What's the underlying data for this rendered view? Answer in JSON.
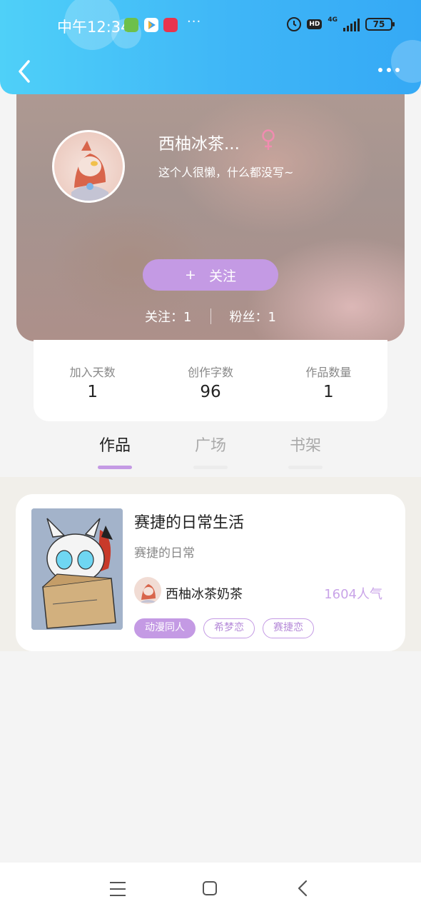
{
  "status_bar": {
    "time": "中午12:34",
    "more": "···",
    "network": "4G",
    "hd_badge": "HD",
    "battery": "75"
  },
  "header": {
    "back_icon": "chevron-left-icon",
    "more_icon": "more-dots-icon"
  },
  "profile": {
    "username": "西柚冰茶...",
    "gender_icon": "female-icon",
    "bio": "这个人很懒，什么都没写~",
    "follow_button": "关注",
    "follow_plus": "+",
    "following_label": "关注：1",
    "followers_label": "粉丝：1",
    "follow_button_color": "#c49ae4"
  },
  "stats": [
    {
      "label": "加入天数",
      "value": "1"
    },
    {
      "label": "创作字数",
      "value": "96"
    },
    {
      "label": "作品数量",
      "value": "1"
    }
  ],
  "tabs": [
    {
      "label": "作品",
      "active": true
    },
    {
      "label": "广场",
      "active": false
    },
    {
      "label": "书架",
      "active": false
    }
  ],
  "works": [
    {
      "title": "赛捷的日常生活",
      "description": "赛捷的日常",
      "author": "西柚冰茶奶茶",
      "popularity": "1604人气",
      "tags": [
        "动漫同人",
        "希梦恋",
        "赛捷恋"
      ]
    }
  ],
  "colors": {
    "header_gradient_start": "#4fd0f8",
    "header_gradient_end": "#35a9f5",
    "accent_purple": "#c49ae4"
  },
  "navbar": {
    "icons": [
      "menu-icon",
      "home-icon",
      "back-icon"
    ]
  }
}
